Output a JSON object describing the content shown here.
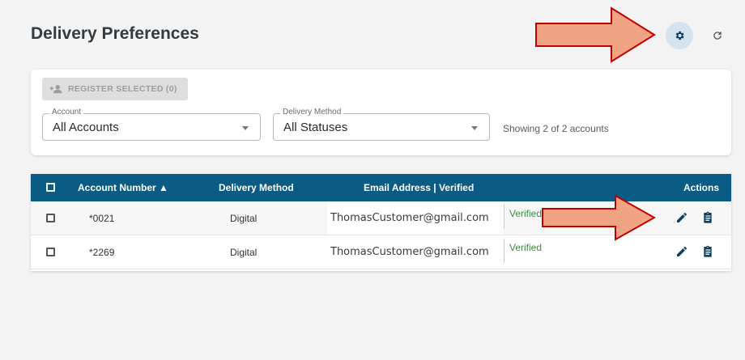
{
  "header": {
    "title": "Delivery Preferences",
    "settings_icon": "gear-icon",
    "refresh_icon": "refresh-icon"
  },
  "filters": {
    "register_button": "REGISTER SELECTED (0)",
    "account_label": "Account",
    "account_value": "All Accounts",
    "delivery_label": "Delivery Method",
    "delivery_value": "All Statuses",
    "showing_text": "Showing 2 of 2 accounts"
  },
  "table": {
    "headers": {
      "account": "Account Number ▲",
      "delivery": "Delivery Method",
      "email": "Email Address | Verified",
      "actions": "Actions"
    },
    "rows": [
      {
        "account": "*0021",
        "delivery": "Digital",
        "email": "ThomasCustomer@gmail.com",
        "verified": "Verified"
      },
      {
        "account": "*2269",
        "delivery": "Digital",
        "email": "ThomasCustomer@gmail.com",
        "verified": "Verified"
      }
    ]
  },
  "colors": {
    "header_bg": "#0b5c84",
    "verified": "#3d8b40",
    "action_icon": "#0b3d5c",
    "annotation_arrow": "#f0a484",
    "annotation_outline": "#c00000"
  }
}
